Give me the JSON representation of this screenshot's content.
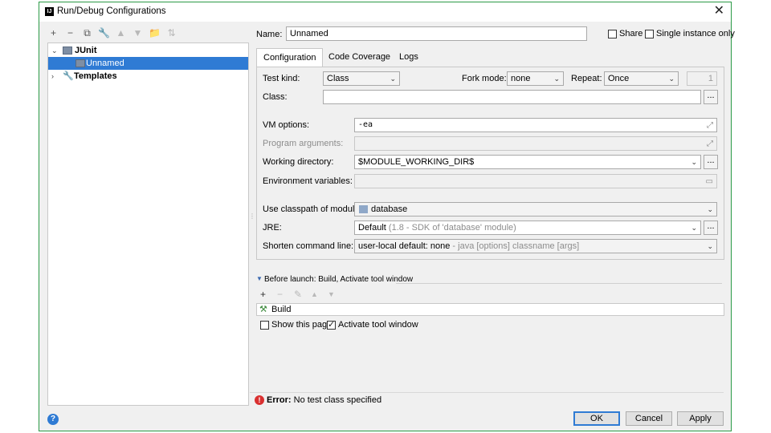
{
  "window": {
    "title": "Run/Debug Configurations",
    "close_glyph": "✕",
    "icon_letter": "IJ"
  },
  "left_toolbar": {
    "icons": [
      "add-icon",
      "remove-icon",
      "copy-icon",
      "wrench-icon",
      "move-up-icon",
      "move-down-icon",
      "folder-icon",
      "sort-icon"
    ],
    "glyphs": [
      "+",
      "−",
      "⧉",
      "🔧",
      "▲",
      "▼",
      "📁",
      "⇅"
    ]
  },
  "tree": {
    "items": [
      {
        "label": "JUnit",
        "expanded": true
      },
      {
        "label": "Unnamed",
        "selected": true
      },
      {
        "label": "Templates",
        "expanded": false
      }
    ],
    "expanded_glyph": "⌄",
    "collapsed_glyph": "›"
  },
  "name": {
    "label": "Name:",
    "value": "Unnamed"
  },
  "share": {
    "label": "Share",
    "checked": false
  },
  "single_instance": {
    "label": "Single instance only",
    "checked": false
  },
  "tabs": [
    "Configuration",
    "Code Coverage",
    "Logs"
  ],
  "config": {
    "test_kind": {
      "label": "Test kind:",
      "value": "Class"
    },
    "fork_mode": {
      "label": "Fork mode:",
      "value": "none"
    },
    "repeat": {
      "label": "Repeat:",
      "value": "Once",
      "count": "1"
    },
    "class": {
      "label": "Class:",
      "value": ""
    },
    "vm_options": {
      "label": "VM options:",
      "value": "-ea"
    },
    "program_arguments": {
      "label": "Program arguments:",
      "value": ""
    },
    "working_directory": {
      "label": "Working directory:",
      "value": "$MODULE_WORKING_DIR$"
    },
    "environment_variables": {
      "label": "Environment variables:",
      "value": ""
    },
    "classpath_module": {
      "label": "Use classpath of module:",
      "value": "database"
    },
    "jre": {
      "label": "JRE:",
      "value": "Default",
      "hint": "(1.8 - SDK of 'database' module)"
    },
    "shorten_cmd": {
      "label": "Shorten command line:",
      "value": "user-local default: none",
      "hint": " - java [options] classname [args]"
    },
    "dots": "..."
  },
  "before_launch": {
    "title": "Before launch: Build, Activate tool window",
    "tools": [
      "+",
      "−",
      "✎",
      "▲",
      "▼"
    ],
    "tasks": [
      "Build"
    ]
  },
  "show_this_page": {
    "label": "Show this page",
    "checked": false
  },
  "activate_tool_window": {
    "label": "Activate tool window",
    "checked": true
  },
  "error": {
    "prefix": "Error:",
    "message": "No test class specified"
  },
  "buttons": {
    "ok": "OK",
    "cancel": "Cancel",
    "apply": "Apply"
  },
  "help_glyph": "?"
}
